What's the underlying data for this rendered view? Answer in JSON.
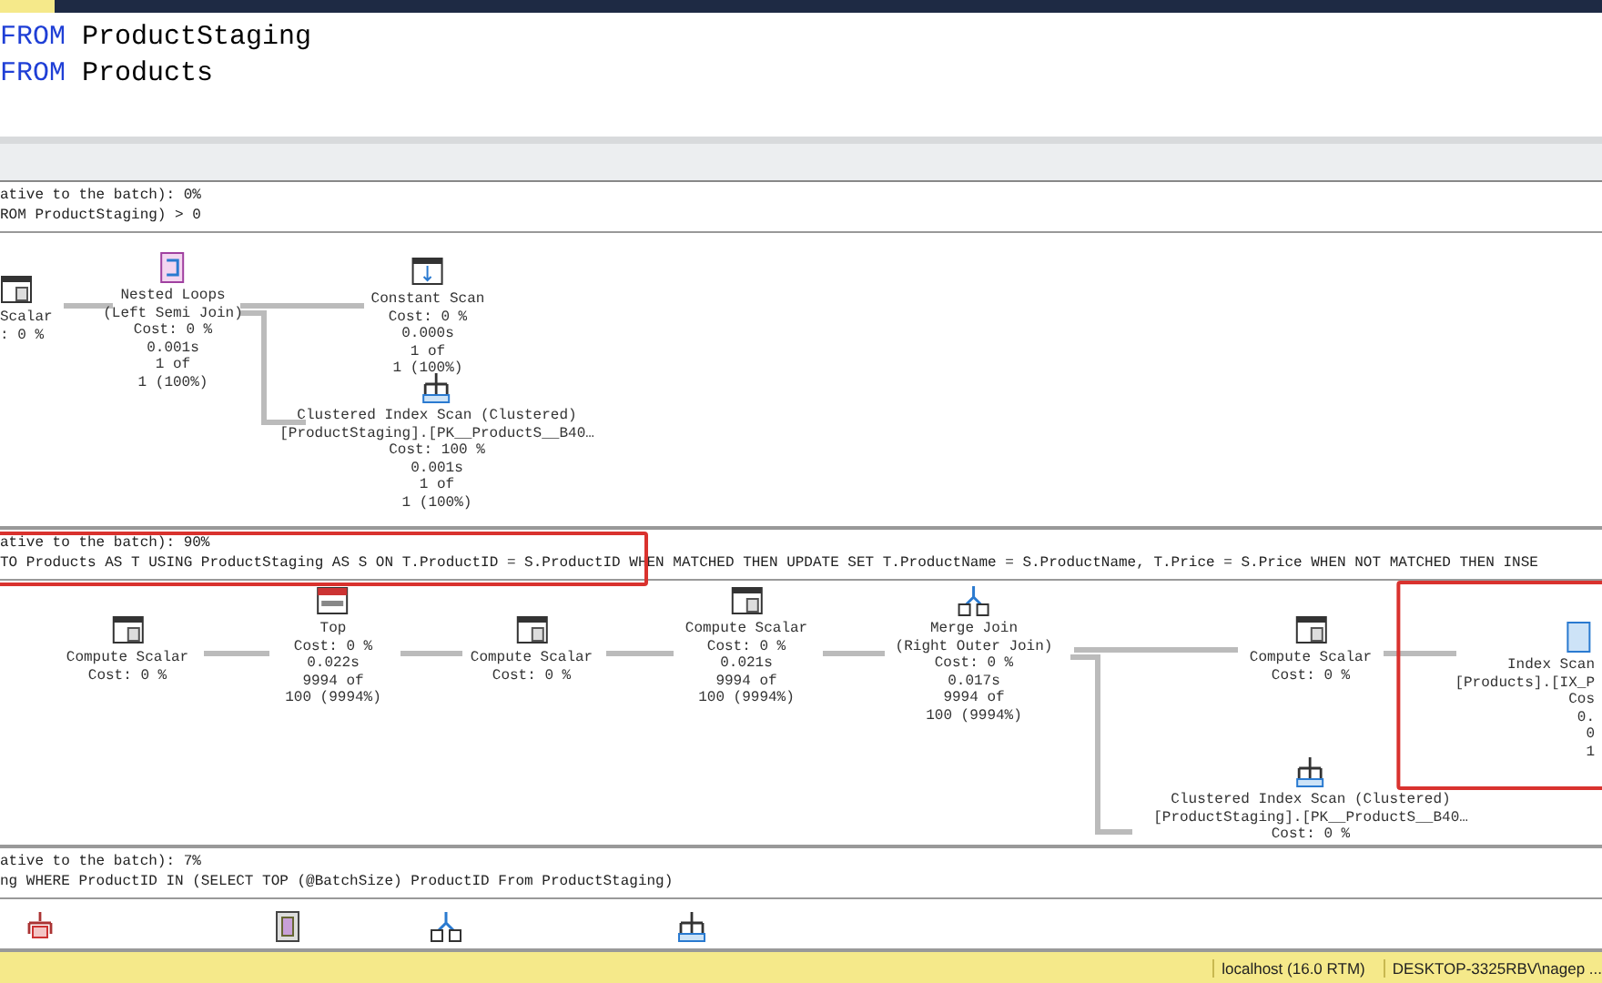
{
  "editor": {
    "lines": [
      {
        "keyword": "FROM",
        "text": "ProductStaging"
      },
      {
        "keyword": "FROM",
        "text": "Products"
      }
    ]
  },
  "plan": {
    "queries": [
      {
        "header_lines": [
          "ative to the batch): 0%",
          "ROM ProductStaging) > 0"
        ],
        "highlighted": false,
        "nodes": [
          {
            "kind": "compute_scalar",
            "lines": [
              "Scalar",
              ": 0 %"
            ],
            "highlighted": false
          },
          {
            "kind": "nested_loops",
            "lines": [
              "Nested Loops",
              "(Left Semi Join)",
              "Cost: 0 %",
              "0.001s",
              "1 of",
              "1 (100%)"
            ],
            "highlighted": false
          },
          {
            "kind": "constant_scan",
            "lines": [
              "Constant Scan",
              "Cost: 0 %",
              "0.000s",
              "1 of",
              "1 (100%)"
            ],
            "highlighted": false
          },
          {
            "kind": "clustered_index_scan",
            "lines": [
              "Clustered Index Scan (Clustered)",
              "[ProductStaging].[PK__ProductS__B40…",
              "Cost: 100 %",
              "0.001s",
              "1 of",
              "1 (100%)"
            ],
            "highlighted": false
          }
        ]
      },
      {
        "header_lines": [
          "ative to the batch): 90%",
          "TO Products AS T USING ProductStaging AS S ON T.ProductID = S.ProductID WHEN MATCHED THEN UPDATE SET T.ProductName = S.ProductName, T.Price = S.Price WHEN NOT MATCHED THEN INSE"
        ],
        "highlighted": true,
        "nodes": [
          {
            "kind": "compute_scalar",
            "lines": [
              "Compute Scalar",
              "Cost: 0 %"
            ],
            "highlighted": false
          },
          {
            "kind": "top",
            "lines": [
              "Top",
              "Cost: 0 %",
              "0.022s",
              "9994 of",
              "100 (9994%)"
            ],
            "highlighted": false
          },
          {
            "kind": "compute_scalar",
            "lines": [
              "Compute Scalar",
              "Cost: 0 %"
            ],
            "highlighted": false
          },
          {
            "kind": "compute_scalar",
            "lines": [
              "Compute Scalar",
              "Cost: 0 %",
              "0.021s",
              "9994 of",
              "100 (9994%)"
            ],
            "highlighted": false
          },
          {
            "kind": "merge_join",
            "lines": [
              "Merge Join",
              "(Right Outer Join)",
              "Cost: 0 %",
              "0.017s",
              "9994 of",
              "100 (9994%)"
            ],
            "highlighted": false
          },
          {
            "kind": "compute_scalar",
            "lines": [
              "Compute Scalar",
              "Cost: 0 %"
            ],
            "highlighted": false
          },
          {
            "kind": "index_scan",
            "lines": [
              "Index Scan",
              "[Products].[IX_P",
              "Cos",
              "0.",
              "0",
              "1"
            ],
            "highlighted": true
          },
          {
            "kind": "clustered_index_scan",
            "lines": [
              "Clustered Index Scan (Clustered)",
              "[ProductStaging].[PK__ProductS__B40…",
              "Cost: 0 %"
            ],
            "highlighted": false
          }
        ]
      },
      {
        "header_lines": [
          "ative to the batch): 7%",
          "ng WHERE ProductID IN (SELECT TOP (@BatchSize) ProductID From ProductStaging)"
        ],
        "highlighted": false,
        "nodes": [
          {
            "kind": "clustered_index_delete",
            "highlighted": false
          },
          {
            "kind": "table_spool",
            "highlighted": false
          },
          {
            "kind": "merge_join",
            "highlighted": false
          },
          {
            "kind": "clustered_index_scan",
            "highlighted": false
          }
        ]
      }
    ]
  },
  "status_bar": {
    "items": [
      "localhost (16.0 RTM)",
      "DESKTOP-3325RBV\\nagep ..."
    ]
  }
}
